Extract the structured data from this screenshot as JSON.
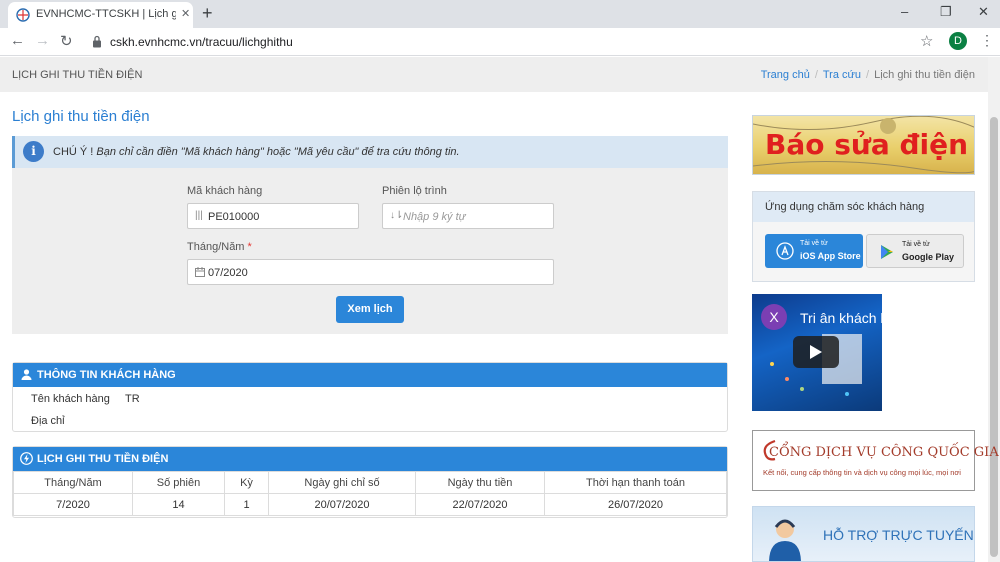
{
  "browser": {
    "tab_title": "EVNHCMC-TTCSKH | Lịch ghi thu",
    "tab_close": "✕",
    "new_tab": "+",
    "url": "cskh.evnhcmc.vn/tracuu/lichghithu",
    "profile_initial": "D",
    "win_minimize": "–",
    "win_restore": "❐",
    "win_close": "✕",
    "back": "←",
    "forward": "→",
    "reload": "↻",
    "star": "☆",
    "menu": "⋮"
  },
  "page_header": {
    "title": "LỊCH GHI THU TIỀN ĐIỆN",
    "breadcrumbs": [
      "Trang chủ",
      "Tra cứu",
      "Lịch ghi thu tiền điện"
    ],
    "separator": "/"
  },
  "main": {
    "title": "Lịch ghi thu tiền điện",
    "notice": {
      "icon_letter": "i",
      "label": "CHÚ Ý !",
      "text": "Bạn chỉ cần điền \"Mã khách hàng\" hoặc \"Mã yêu cầu\" để tra cứu thông tin."
    },
    "form": {
      "customer_code_label": "Mã khách hàng",
      "customer_code_value": "PE010000",
      "route_label": "Phiên lộ trình",
      "route_placeholder": "Nhập 9 ký tự",
      "month_year_label": "Tháng/Năm",
      "required_mark": "*",
      "month_year_value": "07/2020",
      "submit_label": "Xem lịch"
    },
    "customer_info": {
      "heading": "THÔNG TIN KHÁCH HÀNG",
      "name_label": "Tên khách hàng",
      "name_value": "TR",
      "address_label": "Địa chỉ",
      "address_value": ""
    },
    "schedule": {
      "heading": "LỊCH GHI THU TIỀN ĐIỆN",
      "columns": [
        "Tháng/Năm",
        "Số phiên",
        "Kỳ",
        "Ngày ghi chỉ số",
        "Ngày thu tiền",
        "Thời hạn thanh toán"
      ],
      "rows": [
        [
          "7/2020",
          "14",
          "1",
          "20/07/2020",
          "22/07/2020",
          "26/07/2020"
        ]
      ]
    }
  },
  "sidebar": {
    "repair_banner": "Báo sửa điện",
    "app_box_title": "Ứng dụng chăm sóc khách hàng",
    "ios_small": "Tải về từ",
    "ios_big": "iOS App Store",
    "android_small": "Tải về từ",
    "android_big": "Google Play",
    "video_letter": "X",
    "video_title": "Tri ân khách h",
    "public_service_title": "CỔNG DỊCH VỤ CÔNG QUỐC GIA",
    "public_service_sub": "Kết nối, cung cấp thông tin và dịch vụ công mọi lúc, mọi nơi",
    "support_title": "HỖ TRỢ TRỰC TUYẾN"
  },
  "colors": {
    "accent": "#2b86d9",
    "link": "#2b7fd2",
    "notice_bg": "#d8e6f3",
    "required": "#e53935"
  }
}
